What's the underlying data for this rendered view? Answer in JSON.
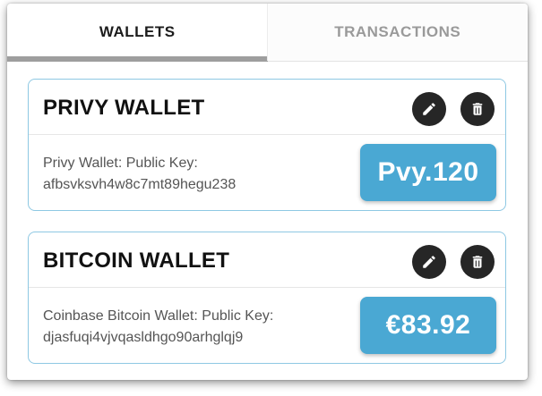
{
  "tabs": [
    {
      "label": "WALLETS",
      "active": true
    },
    {
      "label": "TRANSACTIONS",
      "active": false
    }
  ],
  "wallets": [
    {
      "title": "PRIVY WALLET",
      "description_line1": "Privy Wallet: Public Key:",
      "description_line2": "afbsvksvh4w8c7mt89hegu238",
      "balance": "Pvy.120",
      "edit_icon": "pencil-icon",
      "delete_icon": "trash-icon"
    },
    {
      "title": "BITCOIN WALLET",
      "description_line1": "Coinbase Bitcoin Wallet: Public Key:",
      "description_line2": "djasfuqi4vjvqasldhgo90arhglqj9",
      "balance": "€83.92",
      "edit_icon": "pencil-icon",
      "delete_icon": "trash-icon"
    }
  ],
  "colors": {
    "accent": "#4aa8d3",
    "card_border": "#8ec8e3",
    "icon_button": "#262626",
    "tab_indicator": "#9e9e9e"
  }
}
